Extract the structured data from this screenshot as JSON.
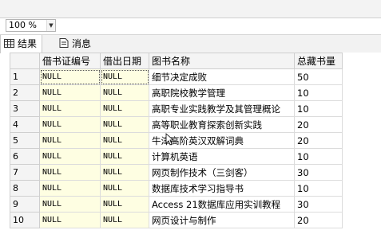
{
  "toolbar": {
    "zoom_value": "100 %"
  },
  "tabs": [
    {
      "label": "结果",
      "icon": "grid-icon"
    },
    {
      "label": "消息",
      "icon": "message-icon"
    }
  ],
  "grid": {
    "columns": [
      "借书证编号",
      "借出日期",
      "图书名称",
      "总藏书量"
    ],
    "rows": [
      {
        "num": "1",
        "card": "NULL",
        "date": "NULL",
        "title": "细节决定成败",
        "total": "50"
      },
      {
        "num": "2",
        "card": "NULL",
        "date": "NULL",
        "title": "高职院校教学管理",
        "total": "10"
      },
      {
        "num": "3",
        "card": "NULL",
        "date": "NULL",
        "title": "高职专业实践教学及其管理概论",
        "total": "10"
      },
      {
        "num": "4",
        "card": "NULL",
        "date": "NULL",
        "title": "高等职业教育探索创新实践",
        "total": "20"
      },
      {
        "num": "5",
        "card": "NULL",
        "date": "NULL",
        "title": "牛津高阶英汉双解词典",
        "total": "20"
      },
      {
        "num": "6",
        "card": "NULL",
        "date": "NULL",
        "title": "计算机英语",
        "total": "10"
      },
      {
        "num": "7",
        "card": "NULL",
        "date": "NULL",
        "title": "网页制作技术（三剑客）",
        "total": "30"
      },
      {
        "num": "8",
        "card": "NULL",
        "date": "NULL",
        "title": "数据库技术学习指导书",
        "total": "10"
      },
      {
        "num": "9",
        "card": "NULL",
        "date": "NULL",
        "title": "Access 21数据库应用实训教程",
        "total": "30"
      },
      {
        "num": "10",
        "card": "NULL",
        "date": "NULL",
        "title": "网页设计与制作",
        "total": "20"
      }
    ]
  }
}
